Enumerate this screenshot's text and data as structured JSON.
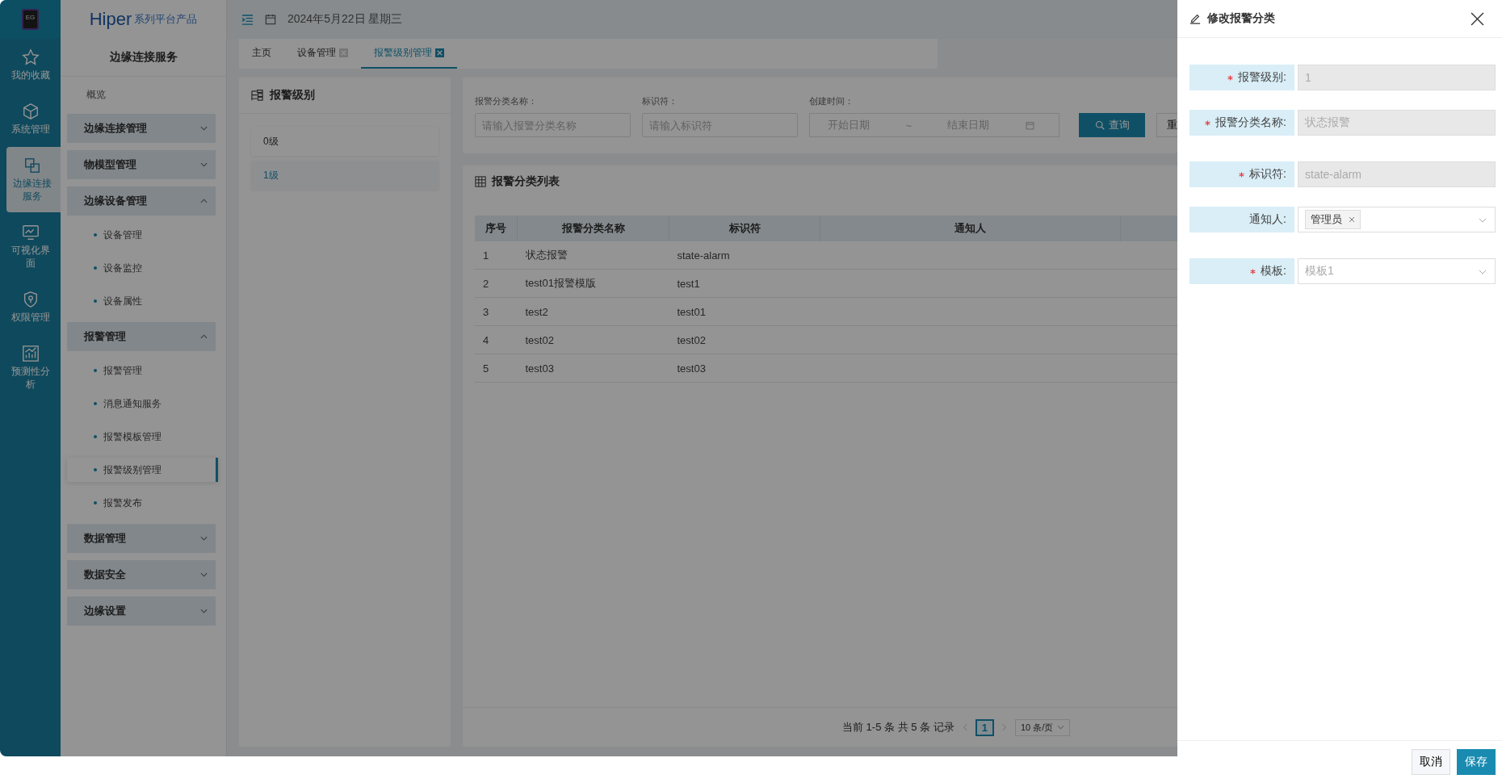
{
  "logo": {
    "badge": "EG",
    "brand": "Hiper",
    "tagline": "系列平台产品"
  },
  "rail": [
    {
      "label": "我的收藏",
      "selected": false
    },
    {
      "label": "系统管理",
      "selected": false
    },
    {
      "label": "边缘连接服务",
      "selected": true
    },
    {
      "label": "可视化界面",
      "selected": false
    },
    {
      "label": "权限管理",
      "selected": false
    },
    {
      "label": "预测性分析",
      "selected": false
    }
  ],
  "sidebar": {
    "title": "边缘连接服务",
    "items": [
      {
        "kind": "link",
        "label": "概览"
      },
      {
        "kind": "group",
        "label": "边缘连接管理",
        "expanded": false
      },
      {
        "kind": "group",
        "label": "物模型管理",
        "expanded": false
      },
      {
        "kind": "group",
        "label": "边缘设备管理",
        "expanded": true,
        "children": [
          {
            "label": "设备管理",
            "selected": false
          },
          {
            "label": "设备监控",
            "selected": false
          },
          {
            "label": "设备属性",
            "selected": false
          }
        ]
      },
      {
        "kind": "group",
        "label": "报警管理",
        "expanded": true,
        "children": [
          {
            "label": "报警管理",
            "selected": false
          },
          {
            "label": "消息通知服务",
            "selected": false
          },
          {
            "label": "报警模板管理",
            "selected": false
          },
          {
            "label": "报警级别管理",
            "selected": true
          },
          {
            "label": "报警发布",
            "selected": false
          }
        ]
      },
      {
        "kind": "group",
        "label": "数据管理",
        "expanded": false
      },
      {
        "kind": "group",
        "label": "数据安全",
        "expanded": false
      },
      {
        "kind": "group",
        "label": "边缘设置",
        "expanded": false
      }
    ]
  },
  "header": {
    "date": "2024年5月22日 星期三"
  },
  "tabs": [
    {
      "label": "主页",
      "selected": false,
      "closable": false
    },
    {
      "label": "设备管理",
      "selected": false,
      "closable": true
    },
    {
      "label": "报警级别管理",
      "selected": true,
      "closable": true
    }
  ],
  "level_panel": {
    "title": "报警级别",
    "items": [
      {
        "label": "0级",
        "selected": false
      },
      {
        "label": "1级",
        "selected": true
      }
    ]
  },
  "filters": {
    "fields": [
      {
        "label": "报警分类名称：",
        "placeholder": "请输入报警分类名称"
      },
      {
        "label": "标识符：",
        "placeholder": "请输入标识符"
      }
    ],
    "date_range": {
      "label": "创建时间：",
      "start": "开始日期",
      "separator": "~",
      "end": "结束日期"
    },
    "search": "查询",
    "reset": "重"
  },
  "table": {
    "title": "报警分类列表",
    "columns": [
      "序号",
      "报警分类名称",
      "标识符",
      "通知人"
    ],
    "rows": [
      [
        "1",
        "状态报警",
        "state-alarm"
      ],
      [
        "2",
        "test01报警模版",
        "test1"
      ],
      [
        "3",
        "test2",
        "test01"
      ],
      [
        "4",
        "test02",
        "test02"
      ],
      [
        "5",
        "test03",
        "test03"
      ]
    ]
  },
  "pagination": {
    "summary": "当前 1-5 条 共 5 条 记录",
    "pages": [
      {
        "label": "1",
        "selected": true
      }
    ],
    "page_size": "10 条/页"
  },
  "drawer": {
    "title": "修改报警分类",
    "fields": [
      {
        "kind": "text",
        "label": "报警级别:",
        "required": true,
        "disabled": true,
        "value": "1"
      },
      {
        "kind": "text",
        "label": "报警分类名称:",
        "required": true,
        "disabled": true,
        "value": "状态报警"
      },
      {
        "kind": "text",
        "label": "标识符:",
        "required": true,
        "disabled": true,
        "value": "state-alarm"
      },
      {
        "kind": "tags",
        "label": "通知人:",
        "required": false,
        "disabled": false,
        "tags": [
          "管理员"
        ]
      },
      {
        "kind": "select",
        "label": "模板:",
        "required": true,
        "disabled": true,
        "value": "模板1"
      }
    ],
    "buttons": [
      {
        "label": "取消",
        "kind": "default"
      },
      {
        "label": "保存",
        "kind": "primary"
      }
    ]
  }
}
